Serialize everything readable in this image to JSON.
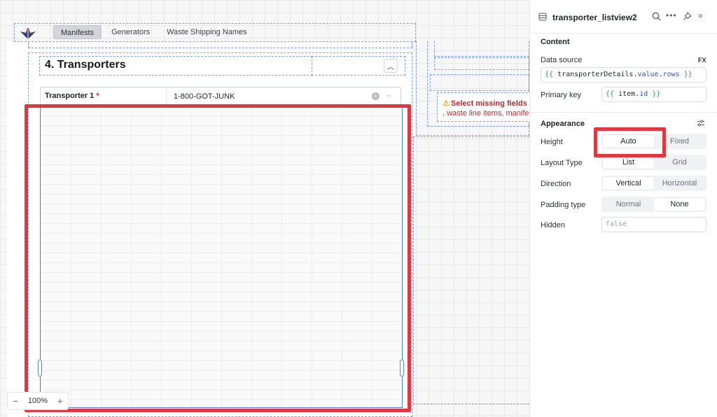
{
  "canvas": {
    "nav_tabs": [
      {
        "label": "Manifests",
        "active": true
      },
      {
        "label": "Generators",
        "active": false
      },
      {
        "label": "Waste Shipping Names",
        "active": false
      }
    ],
    "section_title": "4. Transporters",
    "transporter_field": {
      "label": "Transporter 1",
      "required_mark": "*",
      "value": "1-800-GOT-JUNK"
    },
    "alert": {
      "line1": "Select missing fields to",
      "line2": ", waste line items, manifest"
    },
    "zoom": {
      "minus": "−",
      "level": "100%",
      "plus": "+"
    }
  },
  "panel": {
    "title": "transporter_listview2",
    "content_section": "Content",
    "data_source": {
      "label": "Data source",
      "fx": "FX",
      "open": "{{",
      "object": "transporterDetails",
      "dot1": ".",
      "prop1": "value",
      "dot2": ".",
      "prop2": "rows",
      "close": "}}"
    },
    "primary_key": {
      "label": "Primary key",
      "open": "{{",
      "object": "item",
      "dot": ".",
      "prop": "id",
      "close": "}}"
    },
    "appearance_section": "Appearance",
    "height": {
      "label": "Height",
      "options": [
        "Auto",
        "Fixed"
      ],
      "selected": "Auto"
    },
    "layout_type": {
      "label": "Layout Type",
      "options": [
        "List",
        "Grid"
      ],
      "selected": "List"
    },
    "direction": {
      "label": "Direction",
      "options": [
        "Vertical",
        "Horizontal"
      ],
      "selected": "Vertical"
    },
    "padding_type": {
      "label": "Padding type",
      "options": [
        "Normal",
        "None"
      ],
      "selected": "None"
    },
    "hidden": {
      "label": "Hidden",
      "placeholder": "false"
    }
  },
  "colors": {
    "highlight_red": "#e0383e",
    "selection_blue": "#4f7fe0",
    "alert_red": "#c9252b"
  },
  "icons": {
    "panel_type": "listview-icon",
    "search": "search-icon",
    "more": "more-icon",
    "pin": "pin-icon",
    "collapse": "double-chevron-right-icon",
    "settings": "sliders-icon"
  }
}
